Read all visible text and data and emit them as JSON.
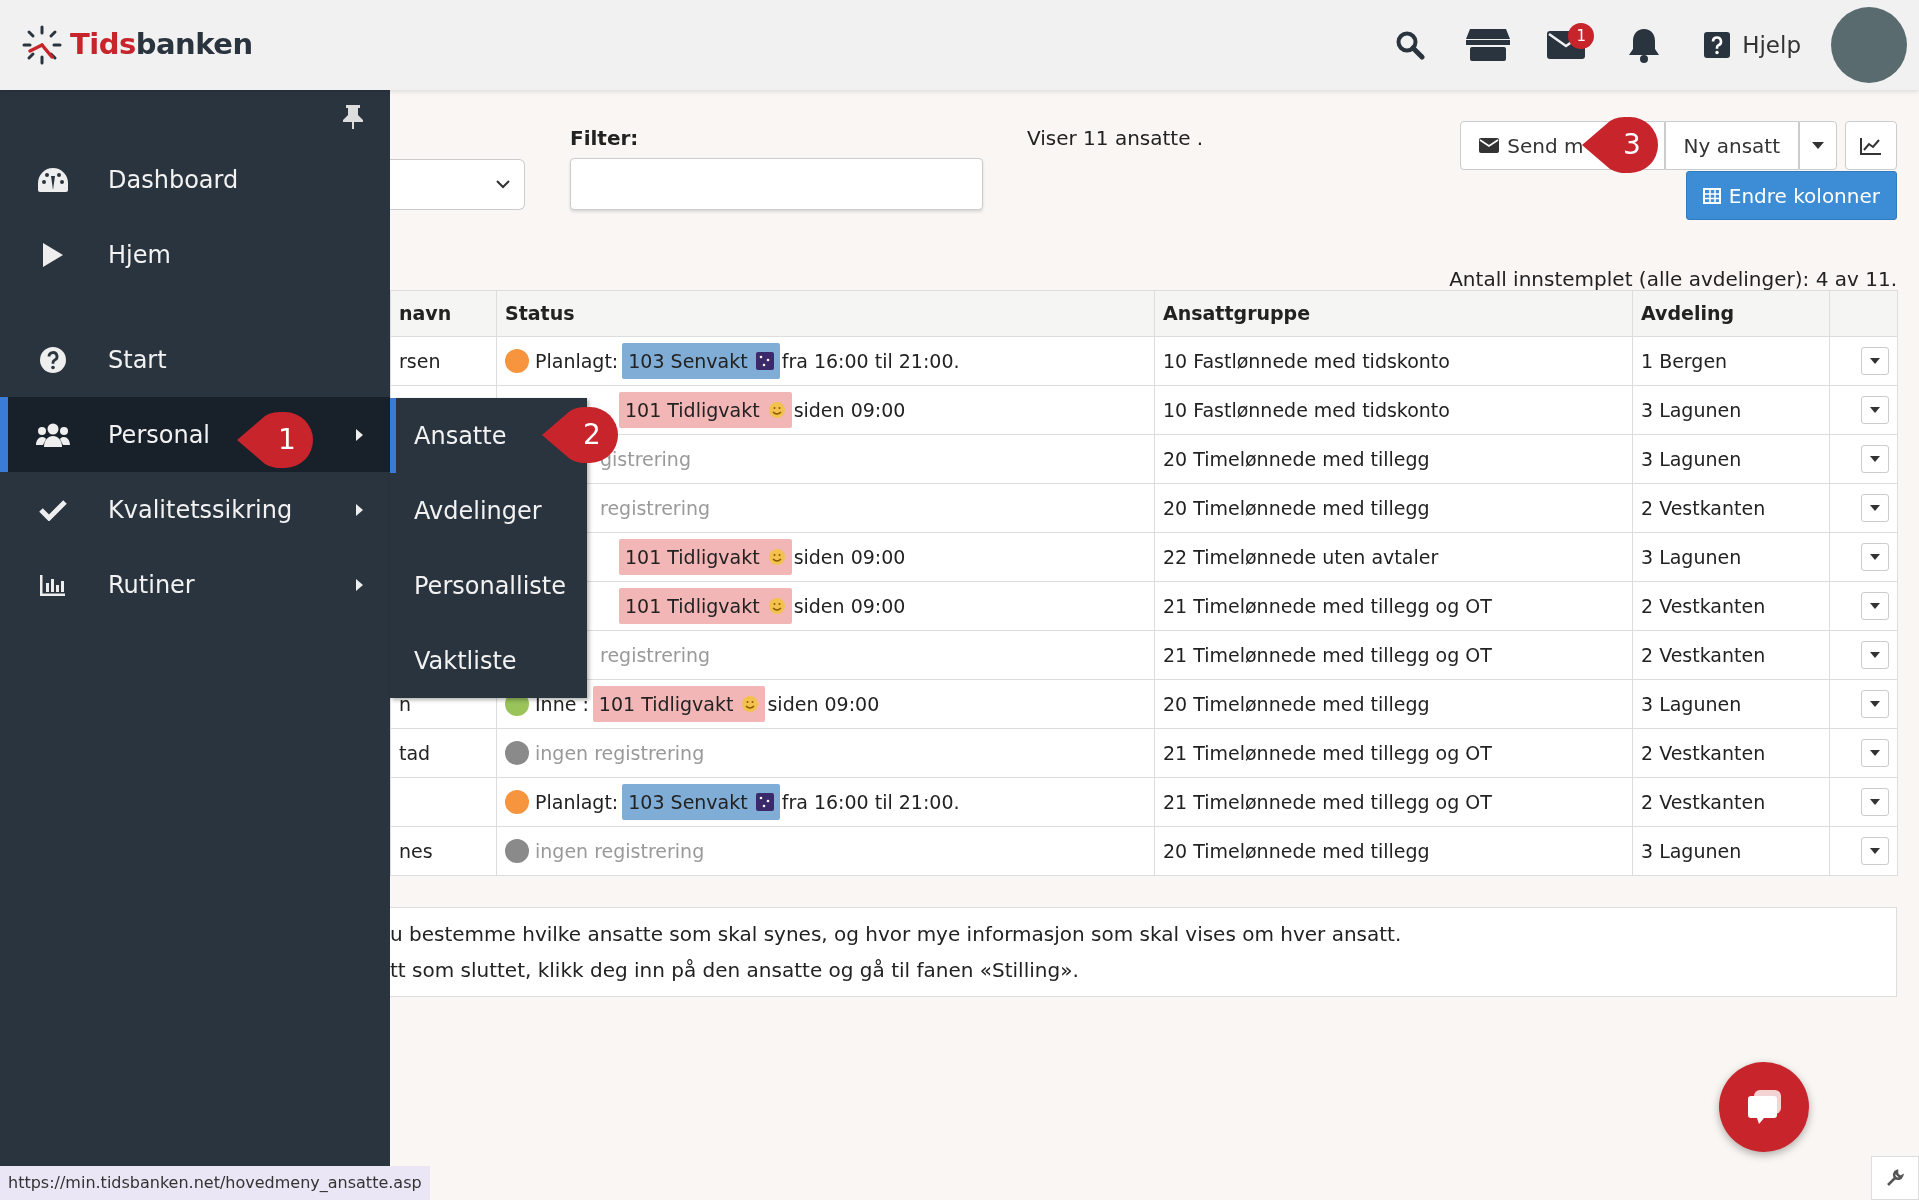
{
  "header": {
    "logo_first": "Tids",
    "logo_second": "banken",
    "mail_badge": "1",
    "help": "Hjelp"
  },
  "sidebar": {
    "items": [
      {
        "label": "Dashboard",
        "selected": false,
        "has_submenu": false
      },
      {
        "label": "Hjem",
        "selected": false,
        "has_submenu": false
      },
      {
        "label": "Start",
        "selected": false,
        "has_submenu": false
      },
      {
        "label": "Personal",
        "selected": true,
        "has_submenu": true
      },
      {
        "label": "Kvalitetssikring",
        "selected": false,
        "has_submenu": true
      },
      {
        "label": "Rutiner",
        "selected": false,
        "has_submenu": true
      }
    ]
  },
  "submenu": {
    "items": [
      {
        "label": "Ansatte",
        "selected": true
      },
      {
        "label": "Avdelinger",
        "selected": false
      },
      {
        "label": "Personalliste",
        "selected": false
      },
      {
        "label": "Vaktliste",
        "selected": false
      }
    ]
  },
  "callouts": [
    {
      "number": "1"
    },
    {
      "number": "2"
    },
    {
      "number": "3"
    }
  ],
  "toolbar": {
    "filter_label": "Filter:",
    "count": "Viser 11 ansatte .",
    "buttons": [
      "Send m",
      "Ny ansatt"
    ],
    "columns_button": "Endre kolonner",
    "summary": "Antall innstemplet (alle avdelinger): 4 av 11."
  },
  "table": {
    "columns": [
      "navn",
      "Status",
      "Ansattgruppe",
      "Avdeling"
    ],
    "rows": [
      {
        "name": "rsen",
        "status": {
          "kind": "full",
          "color": "#f7953f",
          "label": "Planlagt:",
          "badge": {
            "text": "103 Senvakt",
            "color": "#7fadd6"
          },
          "suffix": "fra 16:00 til 21:00."
        },
        "group": "10 Fastlønnede med tidskonto",
        "department": "1 Bergen"
      },
      {
        "status": {
          "kind": "partial",
          "badge": {
            "text": "101 Tidligvakt",
            "color": "#f2b6b6"
          },
          "suffix": "siden 09:00"
        },
        "group": "10 Fastlønnede med tidskonto",
        "department": "3 Lagunen"
      },
      {
        "status": {
          "kind": "partial",
          "muted": "gistrering"
        },
        "group": "20 Timelønnede med tillegg",
        "department": "3 Lagunen"
      },
      {
        "status": {
          "kind": "partial",
          "muted": "registrering"
        },
        "group": "20 Timelønnede med tillegg",
        "department": "2 Vestkanten"
      },
      {
        "status": {
          "kind": "partial",
          "badge": {
            "text": "101 Tidligvakt",
            "color": "#f2b6b6"
          },
          "suffix": "siden 09:00"
        },
        "group": "22 Timelønnede uten avtaler",
        "department": "3 Lagunen"
      },
      {
        "status": {
          "kind": "partial",
          "badge": {
            "text": "101 Tidligvakt",
            "color": "#f2b6b6"
          },
          "suffix": "siden 09:00"
        },
        "group": "21 Timelønnede med tillegg og OT",
        "department": "2 Vestkanten"
      },
      {
        "status": {
          "kind": "partial",
          "muted": "registrering"
        },
        "group": "21 Timelønnede med tillegg og OT",
        "department": "2 Vestkanten"
      },
      {
        "name": "n",
        "status": {
          "kind": "full",
          "color": "#9ac35a",
          "label": "Inne :",
          "badge": {
            "text": "101 Tidligvakt",
            "color": "#f2b6b6"
          },
          "suffix": "siden 09:00"
        },
        "group": "20 Timelønnede med tillegg",
        "department": "3 Lagunen"
      },
      {
        "name": "tad",
        "status": {
          "kind": "full",
          "color": "#8a8a8a",
          "muted": "ingen registrering"
        },
        "group": "21 Timelønnede med tillegg og OT",
        "department": "2 Vestkanten"
      },
      {
        "status": {
          "kind": "full",
          "color": "#f7953f",
          "label": "Planlagt:",
          "badge": {
            "text": "103 Senvakt",
            "color": "#7fadd6"
          },
          "suffix": "fra 16:00 til 21:00."
        },
        "group": "21 Timelønnede med tillegg og OT",
        "department": "2 Vestkanten"
      },
      {
        "name": "nes",
        "status": {
          "kind": "full",
          "color": "#8a8a8a",
          "muted": "ingen registrering"
        },
        "group": "20 Timelønnede med tillegg",
        "department": "3 Lagunen"
      }
    ]
  },
  "info": [
    "u bestemme hvilke ansatte som skal synes, og hvor mye informasjon som skal vises om hver ansatt.",
    "tt som sluttet, klikk deg inn på den ansatte og gå til fanen «Stilling»."
  ],
  "status_bar": "https://min.tidsbanken.net/hovedmeny_ansatte.asp"
}
